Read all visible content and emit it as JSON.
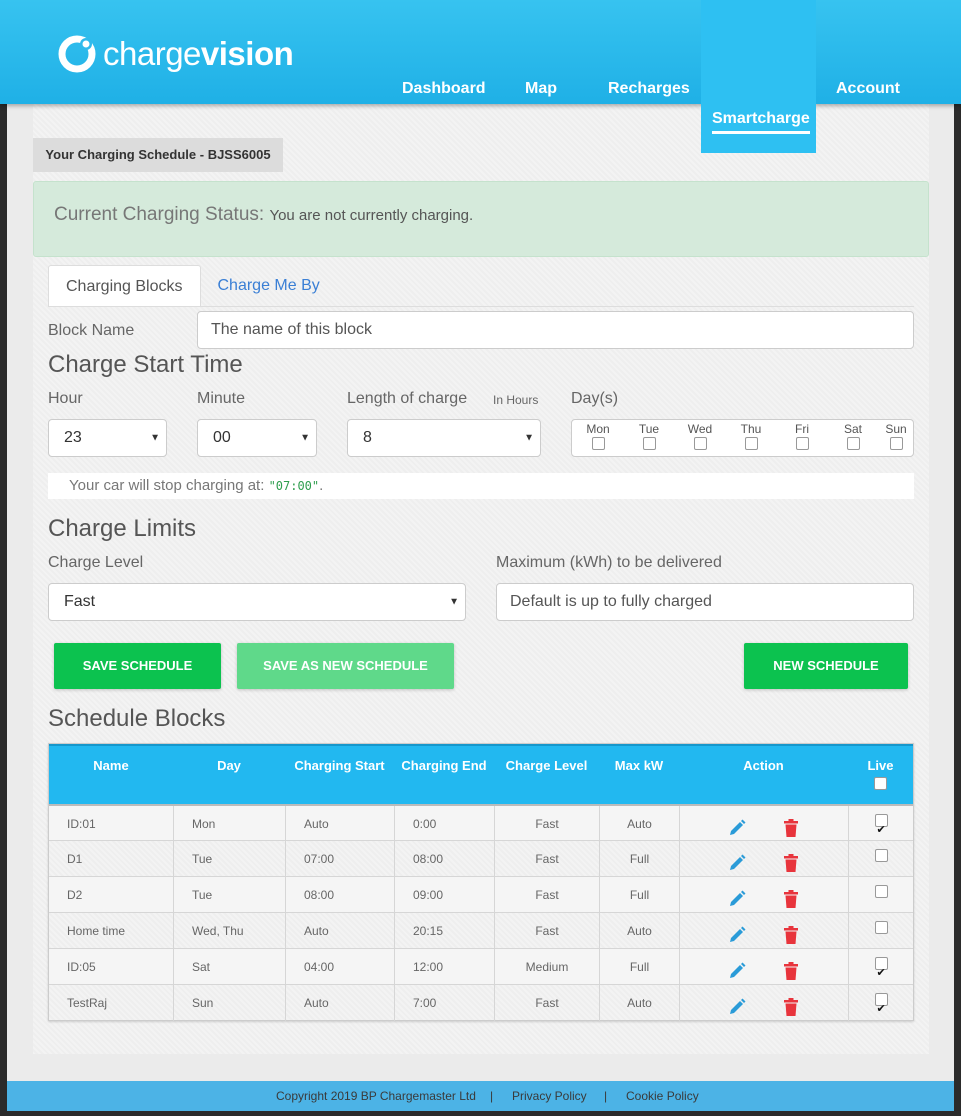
{
  "brand": {
    "name_light": "charge",
    "name_bold": "vision"
  },
  "nav": {
    "dashboard": "Dashboard",
    "map": "Map",
    "recharges": "Recharges",
    "smartcharge": "Smartcharge",
    "account": "Account"
  },
  "schedule_title": "Your Charging Schedule - BJSS6005",
  "status": {
    "label": "Current Charging Status:",
    "text": "You are not currently charging."
  },
  "tabs": {
    "blocks": "Charging Blocks",
    "charge_me_by": "Charge Me By"
  },
  "form": {
    "block_name_label": "Block Name",
    "block_name_placeholder": "The name of this block",
    "start_time_heading": "Charge Start Time",
    "hour_label": "Hour",
    "hour_value": "23",
    "minute_label": "Minute",
    "minute_value": "00",
    "length_label": "Length of charge",
    "length_unit": "In Hours",
    "length_value": "8",
    "days_label": "Day(s)",
    "days": [
      "Mon",
      "Tue",
      "Wed",
      "Thu",
      "Fri",
      "Sat",
      "Sun"
    ],
    "stop_prefix": "Your car will stop charging at: ",
    "stop_time": "\"07:00\"",
    "stop_suffix": ".",
    "limits_heading": "Charge Limits",
    "level_label": "Charge Level",
    "level_value": "Fast",
    "max_label": "Maximum (kWh) to be delivered",
    "max_placeholder": "Default is up to fully charged"
  },
  "buttons": {
    "save": "SAVE SCHEDULE",
    "save_new": "SAVE AS NEW SCHEDULE",
    "new": "NEW SCHEDULE"
  },
  "blocks_heading": "Schedule Blocks",
  "table": {
    "headers": [
      "Name",
      "Day",
      "Charging Start",
      "Charging End",
      "Charge Level",
      "Max kW",
      "Action",
      "Live"
    ],
    "rows": [
      {
        "name": "ID:01",
        "day": "Mon",
        "start": "Auto",
        "end": "0:00",
        "level": "Fast",
        "max": "Auto",
        "live": true
      },
      {
        "name": "D1",
        "day": "Tue",
        "start": "07:00",
        "end": "08:00",
        "level": "Fast",
        "max": "Full",
        "live": false
      },
      {
        "name": "D2",
        "day": "Tue",
        "start": "08:00",
        "end": "09:00",
        "level": "Fast",
        "max": "Full",
        "live": false
      },
      {
        "name": "Home time",
        "day": "Wed, Thu",
        "start": "Auto",
        "end": "20:15",
        "level": "Fast",
        "max": "Auto",
        "live": false
      },
      {
        "name": "ID:05",
        "day": "Sat",
        "start": "04:00",
        "end": "12:00",
        "level": "Medium",
        "max": "Full",
        "live": true
      },
      {
        "name": "TestRaj",
        "day": "Sun",
        "start": "Auto",
        "end": "7:00",
        "level": "Fast",
        "max": "Auto",
        "live": true
      }
    ]
  },
  "footer": {
    "copyright": "Copyright 2019 BP Chargemaster Ltd",
    "sep": "|",
    "privacy": "Privacy Policy",
    "cookie": "Cookie Policy"
  },
  "colors": {
    "header": "#22b8f0",
    "accent_green": "#0cc24f",
    "edit_icon": "#2a9bd8",
    "delete_icon": "#e8343c"
  },
  "icons": {
    "edit": "pencil-icon",
    "delete": "trash-icon"
  }
}
